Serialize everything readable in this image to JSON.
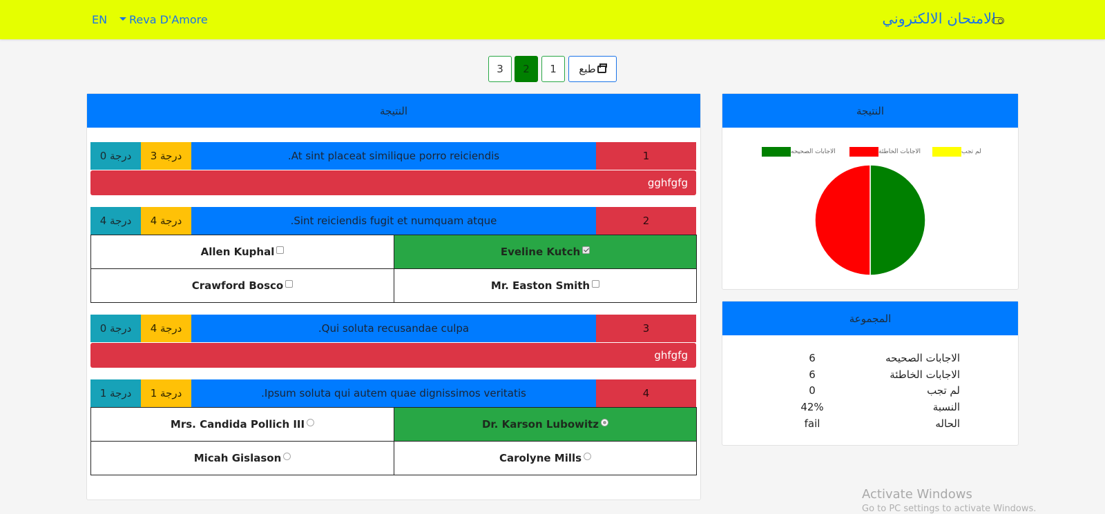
{
  "navbar": {
    "language": "EN",
    "user_name": "Reva D'Amore",
    "brand": "الامتحان الالكتروني",
    "toggle_icon": "toggle-icon"
  },
  "pager": {
    "print_label": "طبع",
    "print_icon": "printer-icon",
    "pages": [
      "1",
      "2",
      "3"
    ],
    "active_page": "2"
  },
  "result_panel": {
    "title": "النتيجة",
    "score_suffix": "درجة",
    "questions": [
      {
        "number": "1",
        "text": ".At sint placeat similique porro reiciendis",
        "score": "3 درجة",
        "total": "0 درجة",
        "answer_text": "gghfgfg"
      },
      {
        "number": "2",
        "text": ".Sint reiciendis fugit et numquam atque",
        "score": "4 درجة",
        "total": "4 درجة",
        "options": [
          {
            "label": "Eveline Kutch",
            "checked": true,
            "correct": true
          },
          {
            "label": "Allen Kuphal",
            "checked": false,
            "correct": false
          },
          {
            "label": "Mr. Easton Smith",
            "checked": false,
            "correct": false
          },
          {
            "label": "Crawford Bosco",
            "checked": false,
            "correct": false
          }
        ]
      },
      {
        "number": "3",
        "text": ".Qui soluta recusandae culpa",
        "score": "4 درجة",
        "total": "0 درجة",
        "answer_text": "ghfgfg"
      },
      {
        "number": "4",
        "text": ".Ipsum soluta qui autem quae dignissimos veritatis",
        "score": "1 درجة",
        "total": "1 درجة",
        "options": [
          {
            "label": "Dr. Karson Lubowitz",
            "checked": true,
            "correct": true
          },
          {
            "label": "Mrs. Candida Pollich III",
            "checked": false,
            "correct": false
          },
          {
            "label": "Carolyne Mills",
            "checked": false,
            "correct": false
          },
          {
            "label": "Micah Gislason",
            "checked": false,
            "correct": false
          }
        ]
      }
    ]
  },
  "chart_panel": {
    "title": "النتيجة"
  },
  "chart_data": {
    "type": "pie",
    "categories": [
      "الاجابات الصحيحه",
      "الاجابات الخاطئة",
      "لم تجب"
    ],
    "values": [
      6,
      6,
      0
    ],
    "colors": [
      "#008000",
      "#ff0000",
      "#ffff00"
    ],
    "legend_position": "top"
  },
  "summary_panel": {
    "title": "المجموعة",
    "rows": [
      {
        "label": "الاجابات الصحيحه",
        "value": "6"
      },
      {
        "label": "الاجابات الخاطئة",
        "value": "6"
      },
      {
        "label": "لم تجب",
        "value": "0"
      },
      {
        "label": "النسبة",
        "value": "42%"
      },
      {
        "label": "الحاله",
        "value": "fail"
      }
    ]
  },
  "watermark": {
    "line1": "Activate Windows",
    "line2": "Go to PC settings to activate Windows."
  }
}
